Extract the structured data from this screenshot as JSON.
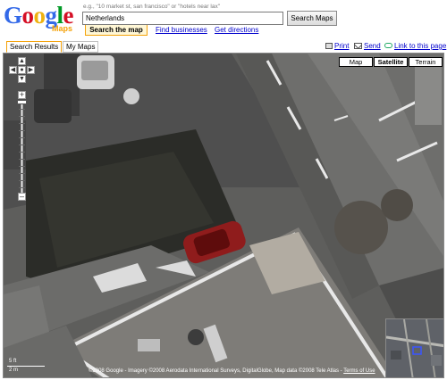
{
  "logo": {
    "g1": "G",
    "o1": "o",
    "o2": "o",
    "g2": "g",
    "l": "l",
    "e": "e",
    "maps": "Maps"
  },
  "search": {
    "hint": "e.g., \"10 market st, san francisco\" or \"hotels near lax\"",
    "value": "Netherlands",
    "button": "Search Maps"
  },
  "subtabs": {
    "search_map": "Search the map",
    "find_businesses": "Find businesses",
    "get_directions": "Get directions"
  },
  "tabs": {
    "search_results": "Search Results",
    "my_maps": "My Maps"
  },
  "links": {
    "print": "Print",
    "send": "Send",
    "link": "Link to this page"
  },
  "map_types": {
    "map": "Map",
    "satellite": "Satellite",
    "terrain": "Terrain",
    "selected": "Satellite"
  },
  "scale": {
    "top": "5 ft",
    "bottom": "2 m"
  },
  "copyright": {
    "text": "©2008 Google - Imagery ©2008 Aerodata International Surveys, DigitalGlobe, Map data ©2008 Tele Atlas - ",
    "terms": "Terms of Use"
  },
  "colors": {
    "g_blue": "#3369e8",
    "g_red": "#d50f25",
    "g_yellow": "#eeb211",
    "g_green": "#009925",
    "accent": "#f4a20a",
    "link": "#0000cc"
  },
  "icons": [
    "print-icon",
    "mail-icon",
    "link-icon",
    "pan-up-icon",
    "pan-down-icon",
    "pan-left-icon",
    "pan-right-icon",
    "pan-center-icon",
    "zoom-in-icon",
    "zoom-out-icon"
  ]
}
